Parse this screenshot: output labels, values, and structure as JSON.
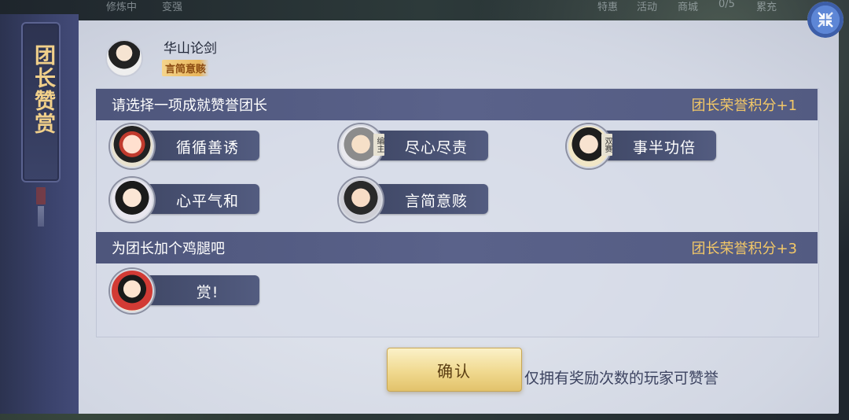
{
  "background": {
    "top_left_items": [
      "修炼中",
      "变强"
    ],
    "top_right_items": [
      "特惠",
      "活动",
      "商城",
      "0/5",
      "累充"
    ]
  },
  "panel": {
    "title": "团长赞赏",
    "leader": {
      "name": "华山论剑",
      "tag": "言简意赅"
    },
    "sections": [
      {
        "heading": "请选择一项成就赞誉团长",
        "points": "团长荣誉积分+1",
        "options": [
          {
            "label": "循循善诱",
            "avatar": "avatar-red-hair"
          },
          {
            "label": "尽心尽责",
            "avatar": "avatar-grey-hair",
            "badge": "编主"
          },
          {
            "label": "事半功倍",
            "avatar": "avatar-dark-hair",
            "badge": "双赛"
          },
          {
            "label": "心平气和",
            "avatar": "avatar-book"
          },
          {
            "label": "言简意赅",
            "avatar": "avatar-angry"
          }
        ]
      },
      {
        "heading": "为团长加个鸡腿吧",
        "points": "团长荣誉积分+3",
        "options": [
          {
            "label": "赏!",
            "avatar": "avatar-feast"
          }
        ]
      }
    ],
    "confirm_label": "确认",
    "hint": "仅拥有奖励次数的玩家可赞誉"
  },
  "icons": {
    "collapse": "collapse-arrows-icon"
  },
  "colors": {
    "accent_gold": "#f3c867",
    "section_header": "#535b82",
    "confirm_gold": "#f0d98f"
  }
}
